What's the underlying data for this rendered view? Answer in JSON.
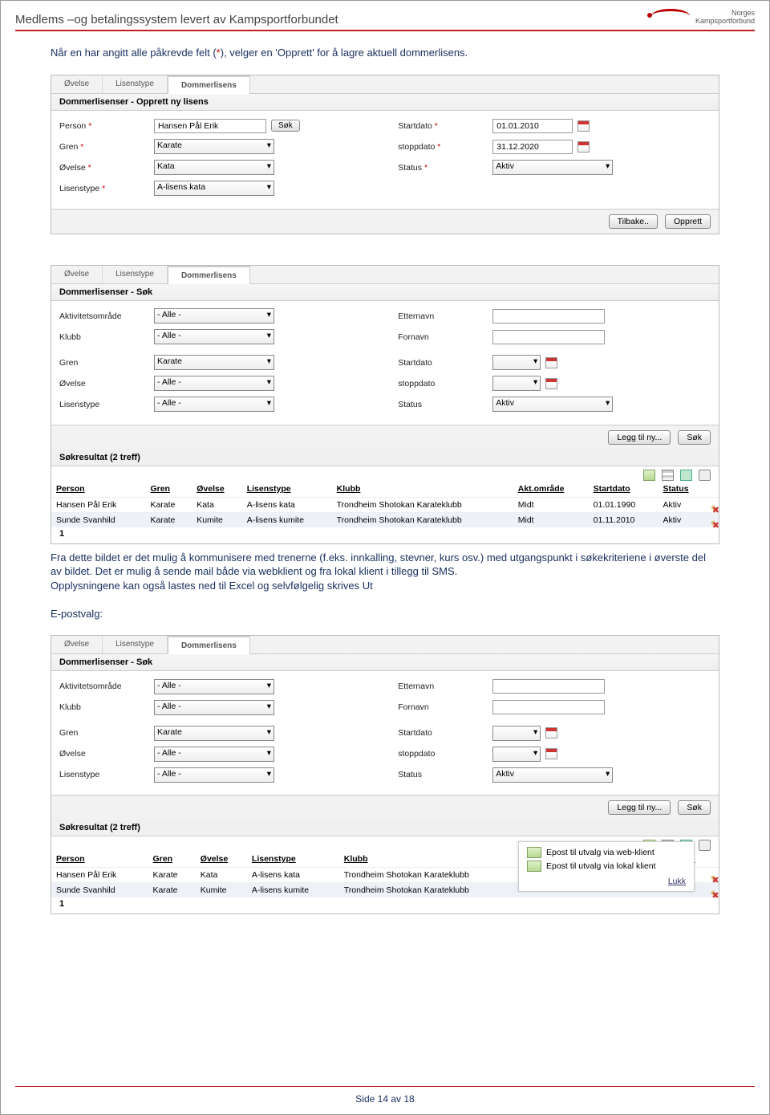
{
  "header": {
    "title": "Medlems –og betalingssystem levert av Kampsportforbundet",
    "logo_line1": "Norges",
    "logo_line2": "Kampsportforbund"
  },
  "intro": {
    "before_star": "Når en har angitt alle påkrevde felt (",
    "star": "*",
    "after_star": "), velger en 'Opprett' for å lagre aktuell dommerlisens."
  },
  "tabs": {
    "ovelse": "Øvelse",
    "lisenstype": "Lisenstype",
    "dommerlisens": "Dommerlisens"
  },
  "panel1": {
    "heading": "Dommerlisenser - Opprett ny lisens",
    "left": {
      "person_lbl": "Person",
      "person_val": "Hansen Pål Erik",
      "sok_btn": "Søk",
      "gren_lbl": "Gren",
      "gren_val": "Karate",
      "ovelse_lbl": "Øvelse",
      "ovelse_val": "Kata",
      "lisenstype_lbl": "Lisenstype",
      "lisenstype_val": "A-lisens kata"
    },
    "right": {
      "startdato_lbl": "Startdato",
      "startdato_val": "01.01.2010",
      "stoppdato_lbl": "stoppdato",
      "stoppdato_val": "31.12.2020",
      "status_lbl": "Status",
      "status_val": "Aktiv"
    },
    "btn_back": "Tilbake..",
    "btn_create": "Opprett"
  },
  "panel2": {
    "heading": "Dommerlisenser - Søk",
    "left": {
      "akt_lbl": "Aktivitetsområde",
      "akt_val": "- Alle -",
      "klubb_lbl": "Klubb",
      "klubb_val": "- Alle -",
      "gren_lbl": "Gren",
      "gren_val": "Karate",
      "ovelse_lbl": "Øvelse",
      "ovelse_val": "- Alle -",
      "lisenstype_lbl": "Lisenstype",
      "lisenstype_val": "- Alle -"
    },
    "right": {
      "etternavn_lbl": "Etternavn",
      "fornavn_lbl": "Fornavn",
      "startdato_lbl": "Startdato",
      "stoppdato_lbl": "stoppdato",
      "status_lbl": "Status",
      "status_val": "Aktiv"
    },
    "btn_add": "Legg til ny...",
    "btn_search": "Søk",
    "result_heading": "Søkresultat (2 treff)",
    "columns": {
      "person": "Person",
      "gren": "Gren",
      "ovelse": "Øvelse",
      "lisenstype": "Lisenstype",
      "klubb": "Klubb",
      "akt": "Akt.område",
      "startdato": "Startdato",
      "status": "Status"
    },
    "rows": [
      {
        "person": "Hansen Pål Erik",
        "gren": "Karate",
        "ovelse": "Kata",
        "lisenstype": "A-lisens kata",
        "klubb": "Trondheim Shotokan Karateklubb",
        "akt": "Midt",
        "startdato": "01.01.1990",
        "status": "Aktiv"
      },
      {
        "person": "Sunde Svanhild",
        "gren": "Karate",
        "ovelse": "Kumite",
        "lisenstype": "A-lisens kumite",
        "klubb": "Trondheim Shotokan Karateklubb",
        "akt": "Midt",
        "startdato": "01.11.2010",
        "status": "Aktiv"
      }
    ],
    "page": "1"
  },
  "middle_text": {
    "p1": "Fra dette bildet er det mulig å kommunisere med trenerne (f.eks. innkalling, stevner, kurs osv.) med utgangspunkt i søkekriteriene i øverste del av bildet. Det er mulig å sende mail både via webklient og fra lokal klient i tillegg til SMS.",
    "p2": "Opplysningene kan også lastes ned til Excel og selvfølgelig skrives Ut",
    "label": "E-postvalg:"
  },
  "panel3": {
    "popup": {
      "opt1": "Epost til utvalg via web-klient",
      "opt2": "Epost til utvalg via lokal klient",
      "close": "Lukk"
    },
    "status_col": "s"
  },
  "footer": "Side 14 av 18"
}
